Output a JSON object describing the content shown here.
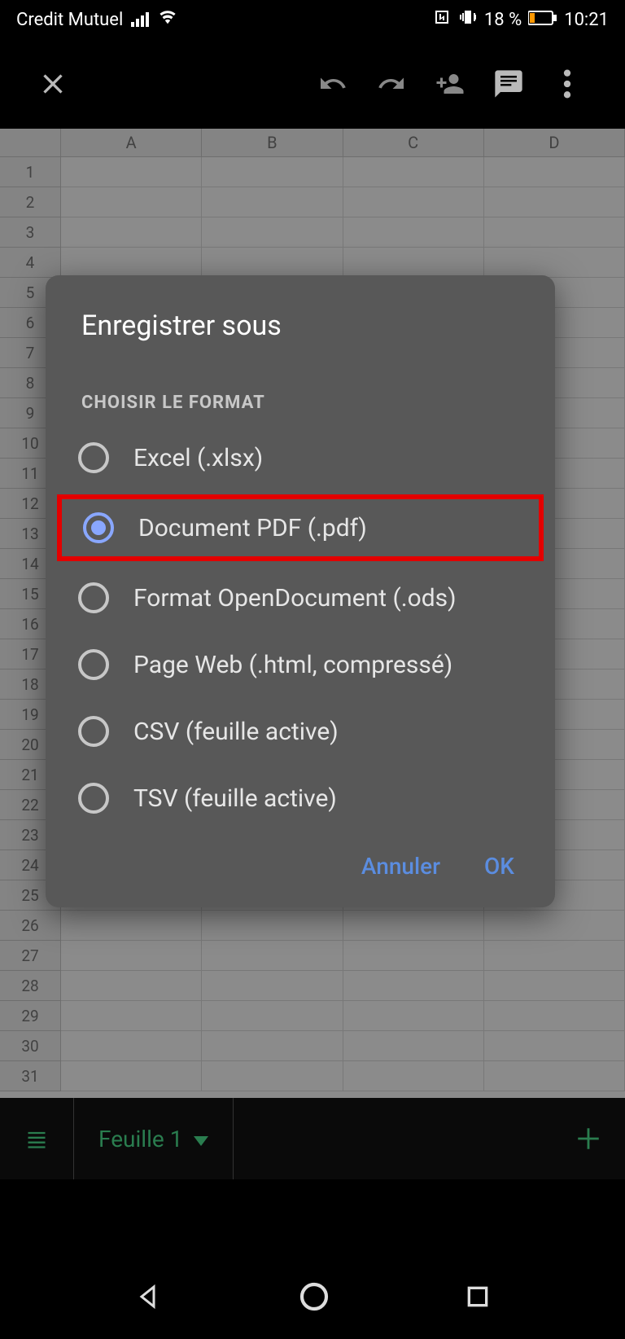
{
  "status": {
    "carrier": "Credit Mutuel",
    "battery_text": "18 %",
    "time": "10:21"
  },
  "spreadsheet": {
    "columns": [
      "A",
      "B",
      "C",
      "D"
    ],
    "rows": [
      "1",
      "2",
      "3",
      "4",
      "5",
      "6",
      "7",
      "8",
      "9",
      "10",
      "11",
      "12",
      "13",
      "14",
      "15",
      "16",
      "17",
      "18",
      "19",
      "20",
      "21",
      "22",
      "23",
      "24",
      "25",
      "26",
      "27",
      "28",
      "29",
      "30",
      "31"
    ]
  },
  "sheet_tab": {
    "name": "Feuille 1"
  },
  "dialog": {
    "title": "Enregistrer sous",
    "subtitle": "CHOISIR LE FORMAT",
    "options": [
      {
        "label": "Excel (.xlsx)",
        "selected": false
      },
      {
        "label": "Document PDF (.pdf)",
        "selected": true
      },
      {
        "label": "Format OpenDocument (.ods)",
        "selected": false
      },
      {
        "label": "Page Web (.html, compressé)",
        "selected": false
      },
      {
        "label": "CSV (feuille active)",
        "selected": false
      },
      {
        "label": "TSV (feuille active)",
        "selected": false
      }
    ],
    "cancel_label": "Annuler",
    "ok_label": "OK"
  }
}
